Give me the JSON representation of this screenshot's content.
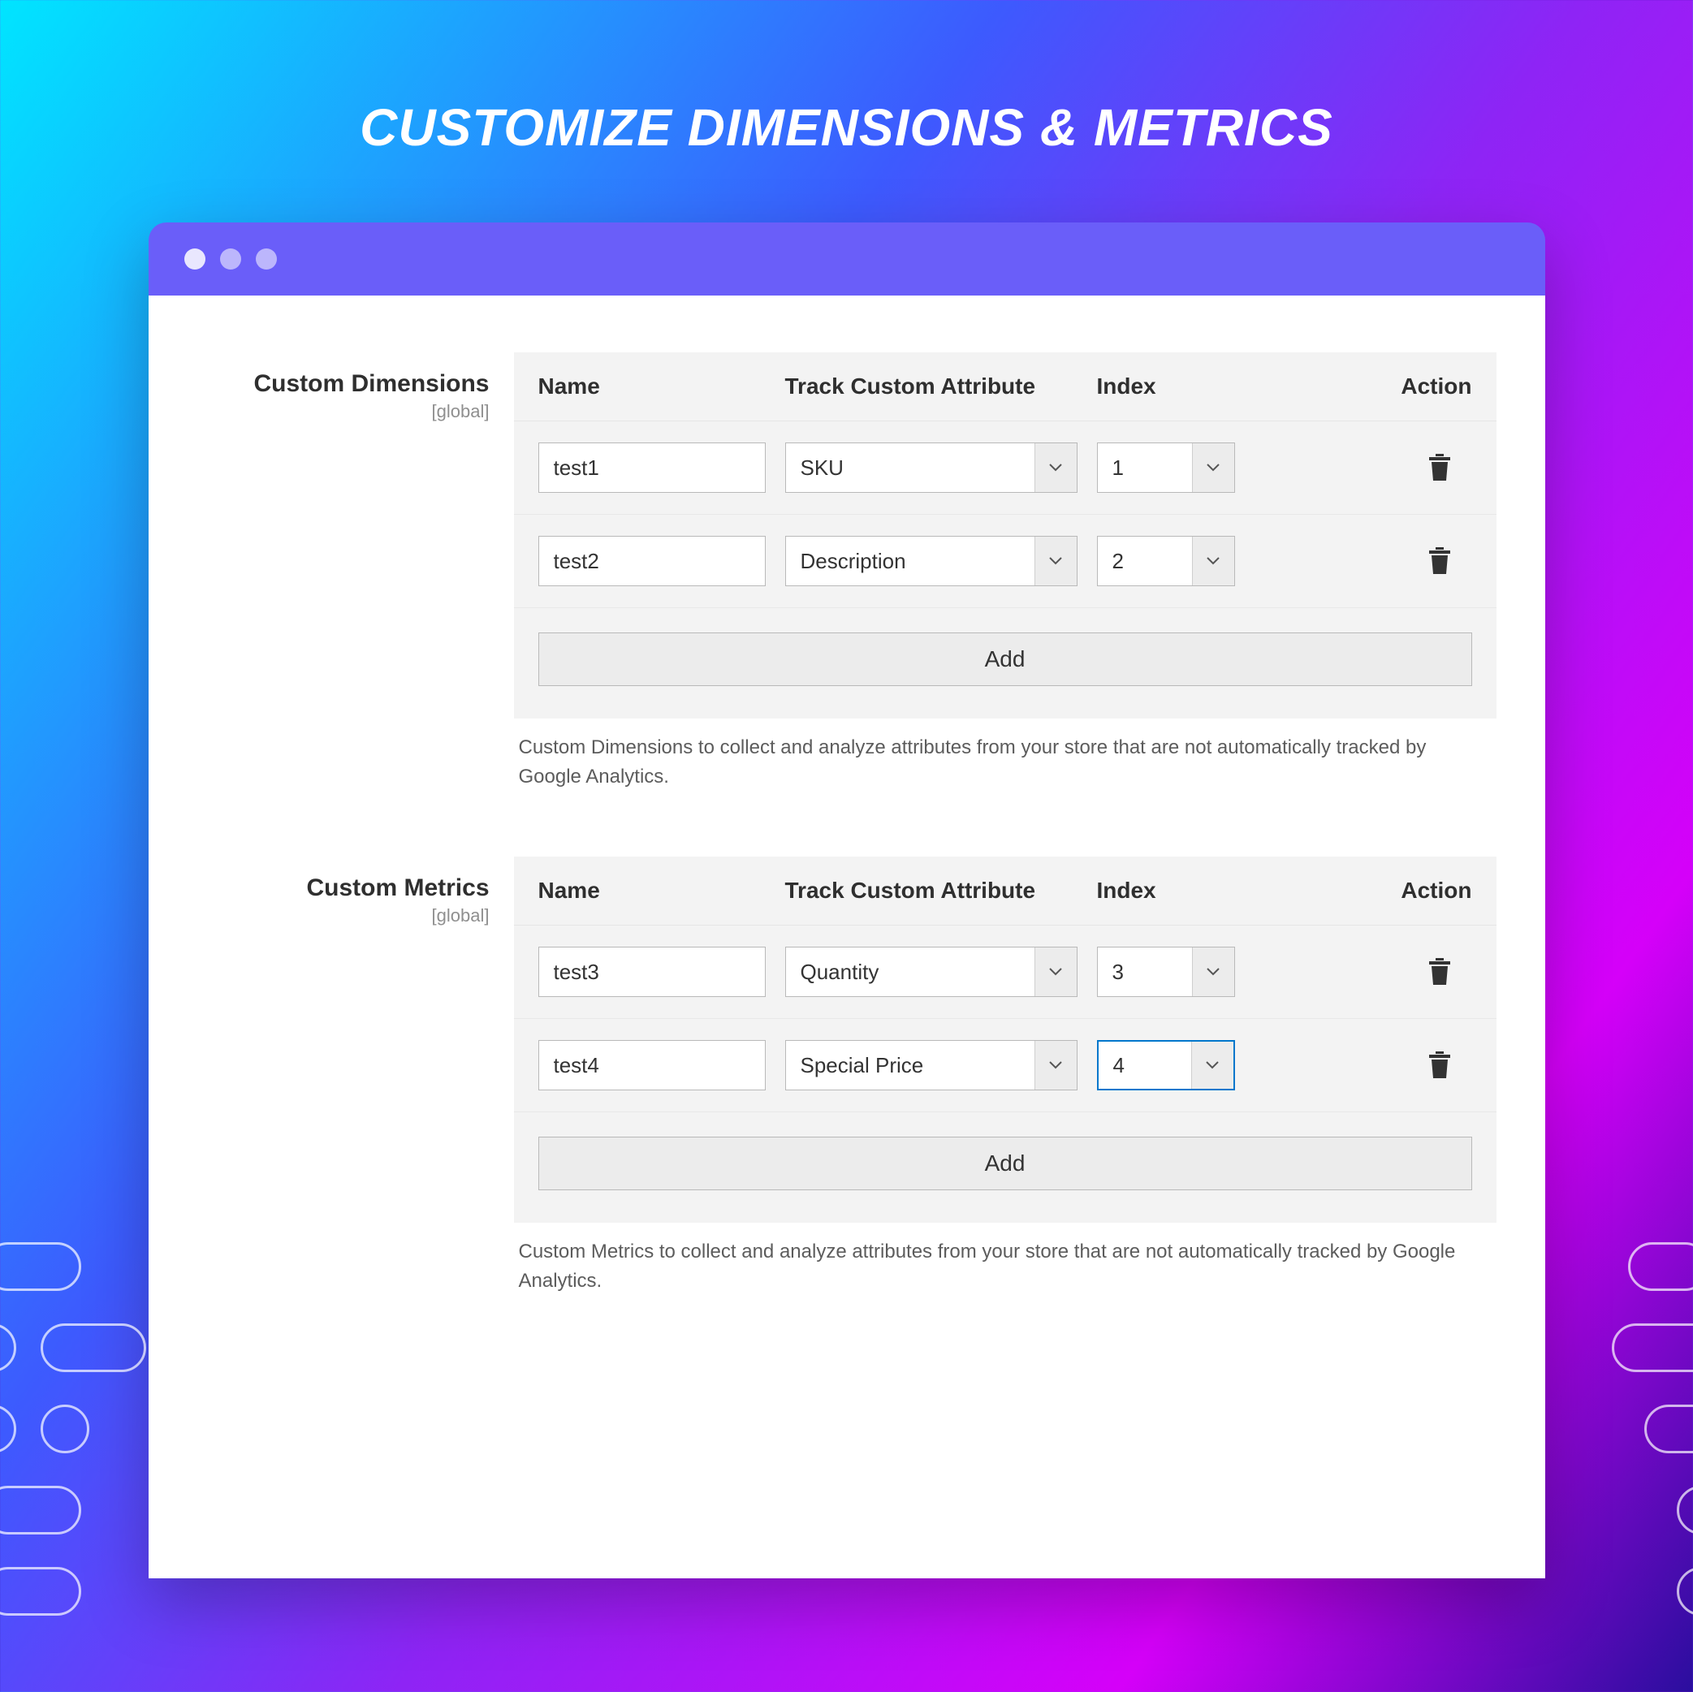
{
  "page": {
    "title": "CUSTOMIZE DIMENSIONS & METRICS"
  },
  "sections": {
    "dimensions": {
      "label": "Custom Dimensions",
      "scope": "[global]",
      "columns": {
        "name": "Name",
        "attribute": "Track Custom Attribute",
        "index": "Index",
        "action": "Action"
      },
      "rows": [
        {
          "name": "test1",
          "attribute": "SKU",
          "index": "1",
          "focused": false
        },
        {
          "name": "test2",
          "attribute": "Description",
          "index": "2",
          "focused": false
        }
      ],
      "add_label": "Add",
      "help": "Custom Dimensions to collect and analyze attributes from your store that are not automatically tracked by Google Analytics."
    },
    "metrics": {
      "label": "Custom Metrics",
      "scope": "[global]",
      "columns": {
        "name": "Name",
        "attribute": "Track Custom Attribute",
        "index": "Index",
        "action": "Action"
      },
      "rows": [
        {
          "name": "test3",
          "attribute": "Quantity",
          "index": "3",
          "focused": false
        },
        {
          "name": "test4",
          "attribute": "Special Price",
          "index": "4",
          "focused": true
        }
      ],
      "add_label": "Add",
      "help": "Custom Metrics to collect and analyze attributes from your store that are not automatically tracked by Google Analytics."
    }
  }
}
